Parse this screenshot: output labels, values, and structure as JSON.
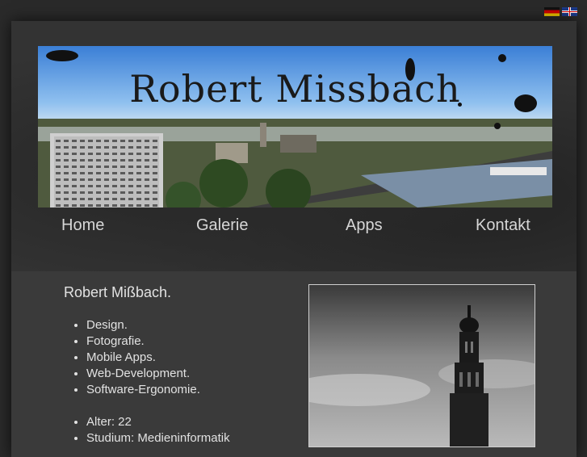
{
  "language_switch": {
    "de_icon": "flag-de-icon",
    "en_icon": "flag-uk-icon"
  },
  "banner": {
    "title": "Robert Missbach"
  },
  "nav": [
    {
      "label": "Home"
    },
    {
      "label": "Galerie"
    },
    {
      "label": "Apps"
    },
    {
      "label": "Kontakt"
    }
  ],
  "content": {
    "intro": "Robert Mißbach.",
    "skills": [
      "Design.",
      "Fotografie.",
      "Mobile Apps.",
      "Web-Development.",
      "Software-Ergonomie."
    ],
    "facts": [
      "Alter: 22",
      "Studium: Medieninformatik"
    ]
  },
  "colors": {
    "background": "#2a2a2a",
    "text": "#e2e2e2",
    "nav_text": "#d6d6d6"
  }
}
